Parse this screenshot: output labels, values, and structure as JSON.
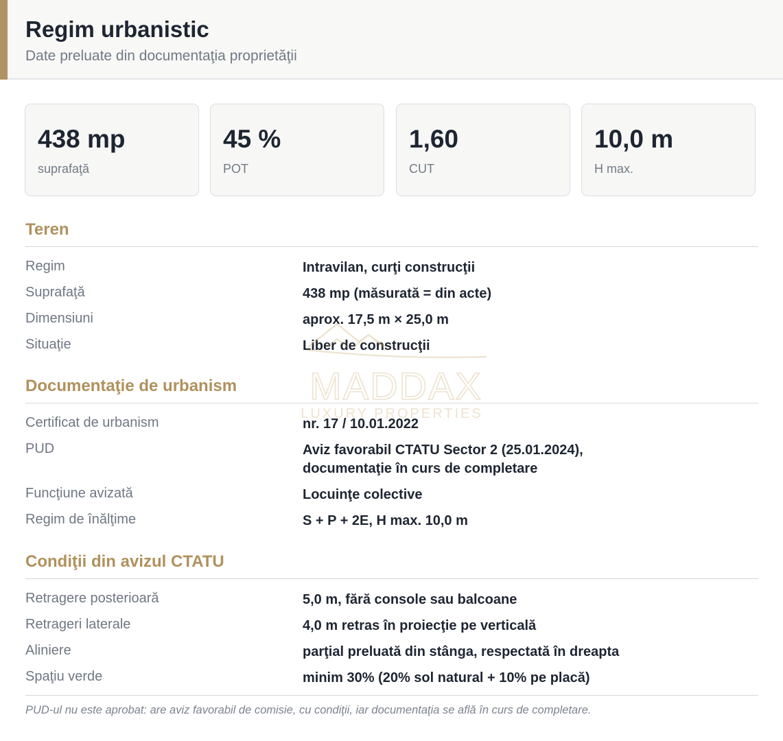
{
  "header": {
    "title": "Regim urbanistic",
    "subtitle": "Date preluate din documentaţia proprietăţii"
  },
  "stats": [
    {
      "value": "438 mp",
      "label": "suprafaţă"
    },
    {
      "value": "45 %",
      "label": "POT"
    },
    {
      "value": "1,60",
      "label": "CUT"
    },
    {
      "value": "10,0 m",
      "label": "H max."
    }
  ],
  "sections": [
    {
      "title": "Teren",
      "rows": [
        {
          "label": "Regim",
          "value": "Intravilan, curţi construcţii"
        },
        {
          "label": "Suprafaţă",
          "value": "438 mp (măsurată = din acte)"
        },
        {
          "label": "Dimensiuni",
          "value": "aprox. 17,5 m × 25,0 m"
        },
        {
          "label": "Situaţie",
          "value": "Liber de construcţii"
        }
      ]
    },
    {
      "title": "Documentaţie de urbanism",
      "rows": [
        {
          "label": "Certificat de urbanism",
          "value": "nr. 17 / 10.01.2022"
        },
        {
          "label": "PUD",
          "value_line1": "Aviz favorabil CTATU Sector 2 (25.01.2024),",
          "value_line2": "documentaţie în curs de completare"
        },
        {
          "label": "Funcţiune avizată",
          "value": "Locuinţe colective"
        },
        {
          "label": "Regim de înălţime",
          "value": "S + P + 2E, H max. 10,0 m"
        }
      ]
    },
    {
      "title": "Condiţii din avizul CTATU",
      "rows": [
        {
          "label": "Retragere posterioară",
          "value": "5,0 m, fără console sau balcoane"
        },
        {
          "label": "Retrageri laterale",
          "value": "4,0 m retras în proiecţie pe verticală"
        },
        {
          "label": "Aliniere",
          "value": "parţial preluată din stânga, respectată în dreapta"
        },
        {
          "label": "Spaţiu verde",
          "value": "minim 30% (20% sol natural + 10% pe placă)"
        }
      ]
    }
  ],
  "footnote": "PUD-ul nu este aprobat: are aviz favorabil de comisie, cu condiţii, iar documentaţia se află în curs de completare.",
  "watermark": {
    "brand": "MADDAX",
    "tagline": "LUXURY PROPERTIES"
  },
  "colors": {
    "accent": "#b0915d",
    "title": "#1e2532",
    "muted": "#6f7783"
  }
}
